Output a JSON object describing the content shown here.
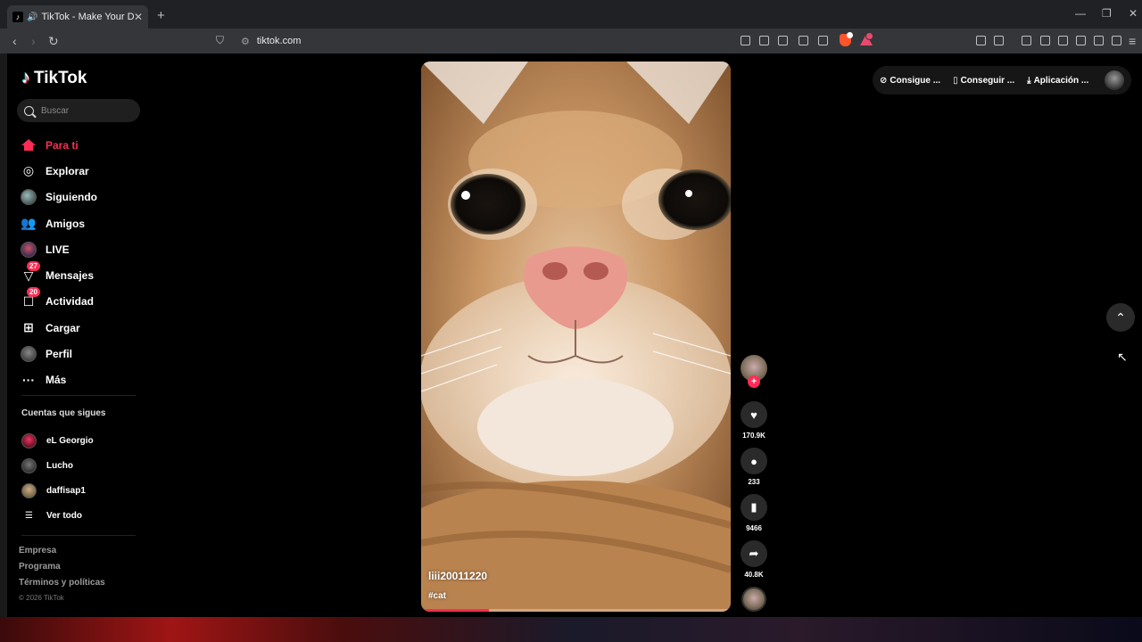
{
  "browser": {
    "tab_title": "TikTok - Make Your Day",
    "url": "tiktok.com"
  },
  "sidebar": {
    "logo": "TikTok",
    "search_placeholder": "Buscar",
    "nav": [
      {
        "label": "Para ti",
        "icon": "home-icon",
        "active": true
      },
      {
        "label": "Explorar",
        "icon": "compass-icon"
      },
      {
        "label": "Siguiendo",
        "icon": "avatar"
      },
      {
        "label": "Amigos",
        "icon": "friends-icon"
      },
      {
        "label": "LIVE",
        "icon": "avatar"
      },
      {
        "label": "Mensajes",
        "icon": "send-icon",
        "badge": "27"
      },
      {
        "label": "Actividad",
        "icon": "inbox-icon",
        "badge": "20"
      },
      {
        "label": "Cargar",
        "icon": "upload-icon"
      },
      {
        "label": "Perfil",
        "icon": "avatar"
      },
      {
        "label": "Más",
        "icon": "more-icon"
      }
    ],
    "following_title": "Cuentas que sigues",
    "following": [
      "eL Georgio",
      "Lucho",
      "daffisap1"
    ],
    "see_all": "Ver todo",
    "footer": [
      "Empresa",
      "Programa",
      "Términos y políticas"
    ],
    "copyright": "© 2026 TikTok"
  },
  "topbar": {
    "coins": "Consigue ...",
    "app": "Conseguir ...",
    "download": "Aplicación ..."
  },
  "video": {
    "username": "liii20011220",
    "hashtag": "#cat",
    "progress": 0.22
  },
  "actions": {
    "likes": "170.9K",
    "comments": "233",
    "saves": "9466",
    "shares": "40.8K"
  },
  "colors": {
    "accent": "#fe2c55",
    "background": "#000000"
  }
}
